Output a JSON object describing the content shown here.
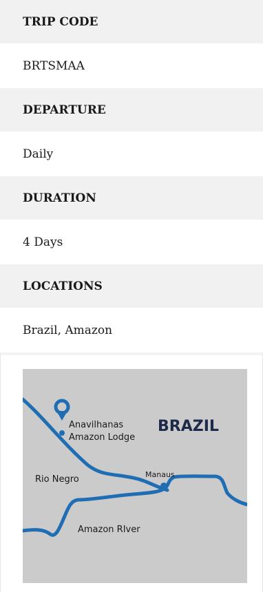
{
  "details": [
    {
      "label": "TRIP CODE",
      "value": "BRTSMAA"
    },
    {
      "label": "DEPARTURE",
      "value": "Daily"
    },
    {
      "label": "DURATION",
      "value": "4 Days"
    },
    {
      "label": "LOCATIONS",
      "value": "Brazil, Amazon"
    }
  ],
  "map": {
    "country": "BRAZIL",
    "lodge_line1": "Anavilhanas",
    "lodge_line2": "Amazon Lodge",
    "rio_negro": "Rio Negro",
    "manaus": "Manaus",
    "amazon_river": "Amazon RIver",
    "colors": {
      "background": "#cbcbcb",
      "river": "#1f6db3",
      "pin": "#1f6db3",
      "country_text": "#1e2a4a"
    }
  }
}
